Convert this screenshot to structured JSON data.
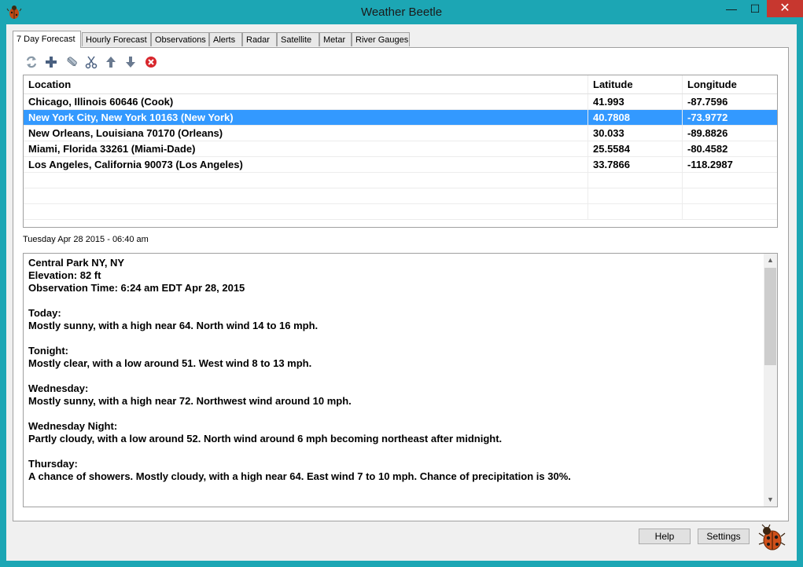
{
  "window": {
    "title": "Weather Beetle",
    "minimize": "—",
    "maximize": "☐",
    "close": "✕"
  },
  "tabs": [
    {
      "label": "7 Day Forecast",
      "active": true
    },
    {
      "label": "Hourly Forecast"
    },
    {
      "label": "Observations"
    },
    {
      "label": "Alerts"
    },
    {
      "label": "Radar"
    },
    {
      "label": "Satellite"
    },
    {
      "label": "Metar"
    },
    {
      "label": "River Gauges"
    }
  ],
  "toolbar": {
    "icons": [
      "refresh-icon",
      "add-icon",
      "edit-icon",
      "cut-icon",
      "move-up-icon",
      "move-down-icon",
      "delete-icon"
    ]
  },
  "grid": {
    "columns": [
      "Location",
      "Latitude",
      "Longitude"
    ],
    "rows": [
      {
        "location": "Chicago, Illinois 60646 (Cook)",
        "lat": "41.993",
        "lon": "-87.7596"
      },
      {
        "location": "New York City, New York 10163 (New York)",
        "lat": "40.7808",
        "lon": "-73.9772",
        "selected": true
      },
      {
        "location": "New Orleans, Louisiana 70170 (Orleans)",
        "lat": "30.033",
        "lon": "-89.8826"
      },
      {
        "location": "Miami, Florida 33261 (Miami-Dade)",
        "lat": "25.5584",
        "lon": "-80.4582"
      },
      {
        "location": "Los Angeles, California 90073 (Los Angeles)",
        "lat": "33.7866",
        "lon": "-118.2987"
      }
    ]
  },
  "timestamp": "Tuesday Apr 28 2015 - 06:40 am",
  "forecast": {
    "station": "Central Park NY, NY",
    "elevation": "Elevation: 82 ft",
    "observation_time": "Observation Time: 6:24 am EDT Apr 28, 2015",
    "periods": [
      {
        "name": "Today:",
        "text": "Mostly sunny, with a high near 64. North wind 14 to 16 mph."
      },
      {
        "name": "Tonight:",
        "text": "Mostly clear, with a low around 51. West wind 8 to 13 mph."
      },
      {
        "name": "Wednesday:",
        "text": "Mostly sunny, with a high near 72. Northwest wind around 10 mph."
      },
      {
        "name": "Wednesday Night:",
        "text": "Partly cloudy, with a low around 52. North wind around 6 mph becoming northeast after midnight."
      },
      {
        "name": "Thursday:",
        "text": "A chance of showers. Mostly cloudy, with a high near 64. East wind 7 to 10 mph. Chance of precipitation is 30%."
      }
    ]
  },
  "buttons": {
    "help": "Help",
    "settings": "Settings"
  },
  "colors": {
    "frame": "#1ca6b4",
    "selection": "#3399ff",
    "close": "#c7372f"
  }
}
